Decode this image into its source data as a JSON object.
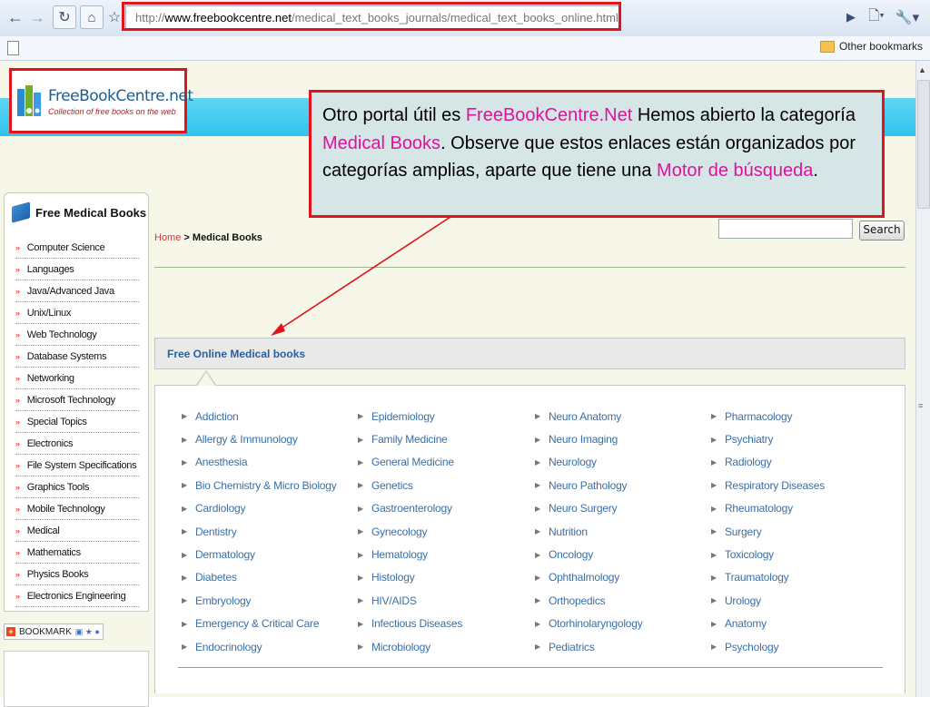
{
  "browser": {
    "url_prefix": "http://",
    "url_host": "www.freebookcentre.net",
    "url_path": "/medical_text_books_journals/medical_text_books_online.html",
    "other_bookmarks": "Other bookmarks"
  },
  "site": {
    "logo_name": "FreeBookCentre.net",
    "logo_tagline": "Collection of free books on the web"
  },
  "sidebar": {
    "title": "Free Medical Books",
    "items": [
      "Computer Science",
      "Languages",
      "Java/Advanced Java",
      "Unix/Linux",
      "Web Technology",
      "Database Systems",
      "Networking",
      "Microsoft Technology",
      "Special Topics",
      "Electronics",
      "File System Specifications",
      "Graphics Tools",
      "Mobile Technology",
      "Medical",
      "Mathematics",
      "Physics Books",
      "Electronics Engineering"
    ],
    "bookmark_label": "BOOKMARK"
  },
  "breadcrumb": {
    "home": "Home",
    "sep": ">",
    "current": "Medical Books"
  },
  "search": {
    "button": "Search"
  },
  "panel": {
    "title": "Free Online Medical books",
    "columns": [
      [
        "Addiction",
        "Allergy & Immunology",
        "Anesthesia",
        "Bio Chemistry & Micro Biology",
        "Cardiology",
        "Dentistry",
        "Dermatology",
        "Diabetes",
        "Embryology",
        "Emergency & Critical Care",
        "Endocrinology"
      ],
      [
        "Epidemiology",
        "Family Medicine",
        "General Medicine",
        "Genetics",
        "Gastroenterology",
        "Gynecology",
        "Hematology",
        "Histology",
        "HIV/AIDS",
        "Infectious Diseases",
        "Microbiology"
      ],
      [
        "Neuro Anatomy",
        "Neuro Imaging",
        "Neurology",
        "Neuro Pathology",
        "Neuro Surgery",
        "Nutrition",
        "Oncology",
        "Ophthalmology",
        "Orthopedics",
        "Otorhinolaryngology",
        "Pediatrics"
      ],
      [
        "Pharmacology",
        "Psychiatry",
        "Radiology",
        "Respiratory Diseases",
        "Rheumatology",
        "Surgery",
        "Toxicology",
        "Traumatology",
        "Urology",
        "Anatomy",
        "Psychology"
      ]
    ]
  },
  "callout": {
    "t1": "Otro portal útil es ",
    "h1": "FreeBookCentre.Net",
    "t2": "  Hemos abierto la categoría ",
    "h2": "Medical Books",
    "t3": ".  Observe que estos enlaces están organizados por categorías amplias, aparte que tiene una ",
    "h3": "Motor de búsqueda",
    "t4": "."
  },
  "colors": {
    "highlight_border": "#e0141c",
    "callout_link": "#e0119e",
    "callout_bg": "#d6e6e6",
    "header_band": "#2ec4ee"
  }
}
